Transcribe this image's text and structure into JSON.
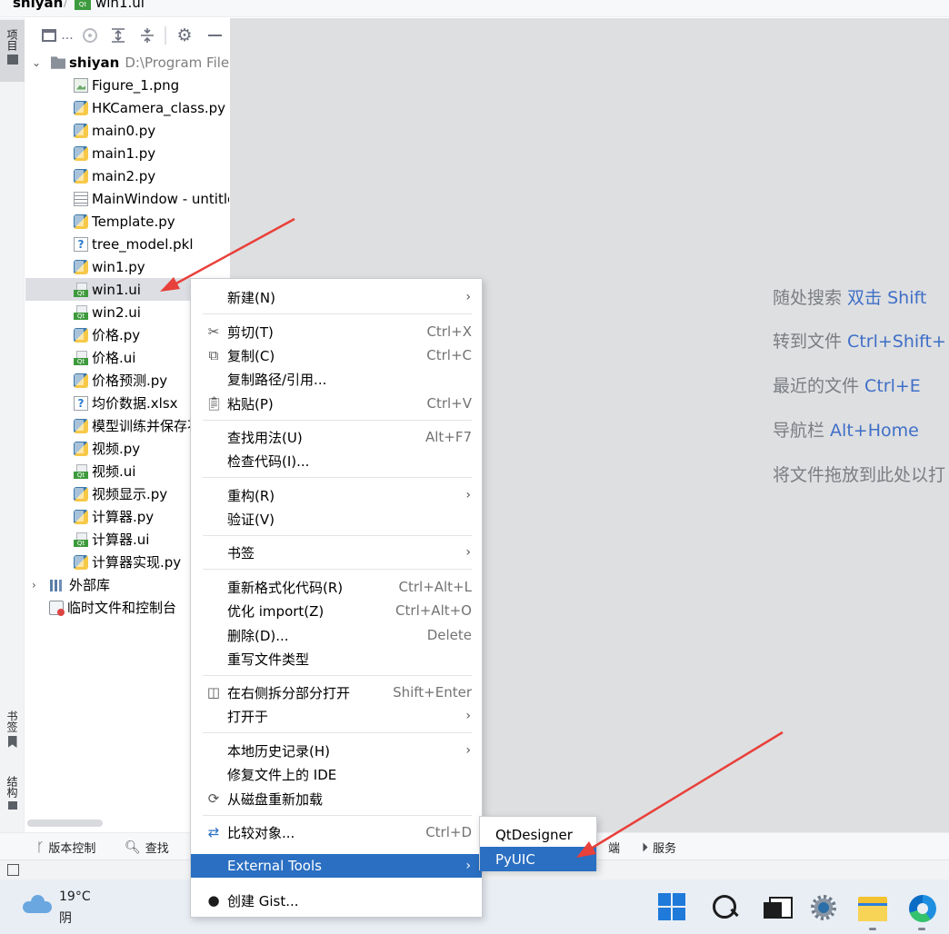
{
  "breadcrumb": {
    "project": "shiyan",
    "file": "win1.ui"
  },
  "left_strip": {
    "project_tab": "项目",
    "bookmarks_tab": "书签",
    "structure_tab": "结构"
  },
  "project_panel": {
    "toolbar": {
      "ellipsis": "..."
    },
    "root": {
      "name": "shiyan",
      "path": "D:\\Program Files"
    },
    "files": [
      {
        "name": "Figure_1.png",
        "icon": "image-icon"
      },
      {
        "name": "HKCamera_class.py",
        "icon": "python-icon"
      },
      {
        "name": "main0.py",
        "icon": "python-icon"
      },
      {
        "name": "main1.py",
        "icon": "python-icon"
      },
      {
        "name": "main2.py",
        "icon": "python-icon"
      },
      {
        "name": "MainWindow - untitle",
        "icon": "text-file-icon"
      },
      {
        "name": "Template.py",
        "icon": "python-icon"
      },
      {
        "name": "tree_model.pkl",
        "icon": "unknown-file-icon"
      },
      {
        "name": "win1.py",
        "icon": "python-icon"
      },
      {
        "name": "win1.ui",
        "icon": "qt-ui-icon",
        "selected": true
      },
      {
        "name": "win2.ui",
        "icon": "qt-ui-icon"
      },
      {
        "name": "价格.py",
        "icon": "python-icon"
      },
      {
        "name": "价格.ui",
        "icon": "qt-ui-icon"
      },
      {
        "name": "价格预测.py",
        "icon": "python-icon"
      },
      {
        "name": "均价数据.xlsx",
        "icon": "unknown-file-icon"
      },
      {
        "name": "模型训练并保存不",
        "icon": "python-icon"
      },
      {
        "name": "视频.py",
        "icon": "python-icon"
      },
      {
        "name": "视频.ui",
        "icon": "qt-ui-icon"
      },
      {
        "name": "视频显示.py",
        "icon": "python-icon"
      },
      {
        "name": "计算器.py",
        "icon": "python-icon"
      },
      {
        "name": "计算器.ui",
        "icon": "qt-ui-icon"
      },
      {
        "name": "计算器实现.py",
        "icon": "python-icon"
      }
    ],
    "external_libraries": "外部库",
    "scratches": "临时文件和控制台"
  },
  "editor_hints": [
    {
      "text": "随处搜索 ",
      "key": "双击 Shift"
    },
    {
      "text": "转到文件 ",
      "key": "Ctrl+Shift+"
    },
    {
      "text": "最近的文件 ",
      "key": "Ctrl+E"
    },
    {
      "text": "导航栏 ",
      "key": "Alt+Home"
    },
    {
      "text": "将文件拖放到此处以打",
      "key": ""
    }
  ],
  "context_menu": {
    "new": "新建(N)",
    "cut": "剪切(T)",
    "cut_shortcut": "Ctrl+X",
    "copy": "复制(C)",
    "copy_shortcut": "Ctrl+C",
    "copy_path": "复制路径/引用...",
    "paste": "粘贴(P)",
    "paste_shortcut": "Ctrl+V",
    "find_usages": "查找用法(U)",
    "find_usages_shortcut": "Alt+F7",
    "inspect_code": "检查代码(I)...",
    "refactor": "重构(R)",
    "validate": "验证(V)",
    "bookmarks": "书签",
    "reformat": "重新格式化代码(R)",
    "reformat_shortcut": "Ctrl+Alt+L",
    "optimize_imports": "优化 import(Z)",
    "optimize_imports_shortcut": "Ctrl+Alt+O",
    "delete": "删除(D)...",
    "delete_shortcut": "Delete",
    "override_file_type": "重写文件类型",
    "split_right": "在右侧拆分部分打开",
    "split_right_shortcut": "Shift+Enter",
    "open_in": "打开于",
    "local_history": "本地历史记录(H)",
    "repair_ide": "修复文件上的 IDE",
    "reload_from_disk": "从磁盘重新加载",
    "compare_with": "比较对象...",
    "compare_with_shortcut": "Ctrl+D",
    "external_tools": "External Tools",
    "create_gist": "创建 Gist..."
  },
  "submenu": {
    "items": [
      "QtDesigner",
      "PyUIC"
    ],
    "highlighted": "PyUIC"
  },
  "bottom_bar": {
    "vcs": "版本控制",
    "find": "查找",
    "terminal_partial": "端",
    "services": "服务"
  },
  "taskbar": {
    "temperature": "19°C",
    "condition": "阴"
  },
  "colors": {
    "accent": "#2a6fc2",
    "annotation_arrow": "#e8403a"
  }
}
